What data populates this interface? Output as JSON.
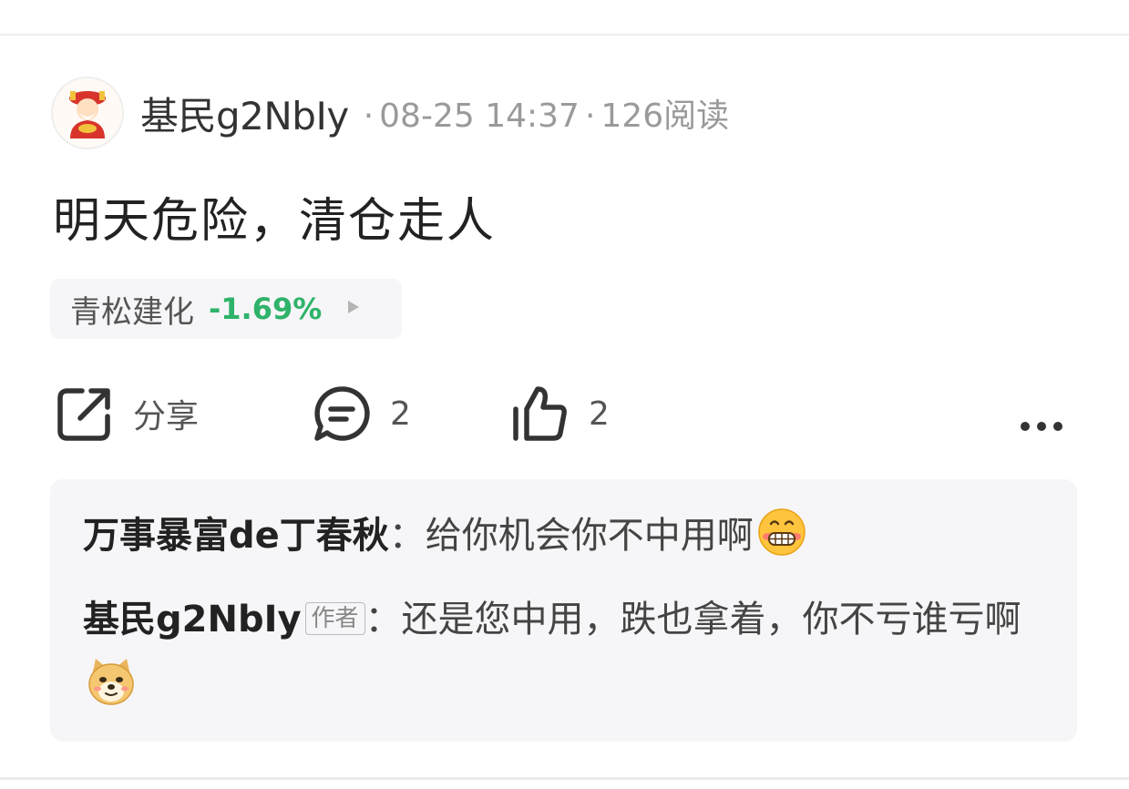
{
  "post": {
    "author": "基民g2NbIy",
    "date": "08-25 14:37",
    "reads": "126阅读",
    "separator": "·",
    "text": "明天危险，清仓走人"
  },
  "stock": {
    "name": "青松建化",
    "change": "-1.69%",
    "change_color": "#2fb36a"
  },
  "actions": {
    "share_label": "分享",
    "comment_count": "2",
    "like_count": "2"
  },
  "comments": [
    {
      "user": "万事暴富de丁春秋",
      "colon": "：",
      "text": "给你机会你不中用啊",
      "emoji": "grinning-emoji"
    },
    {
      "user": "基民g2NbIy",
      "tag": "作者",
      "colon": "：",
      "text": "还是您中用，跌也拿着，你不亏谁亏啊",
      "emoji": "doge-emoji"
    }
  ]
}
